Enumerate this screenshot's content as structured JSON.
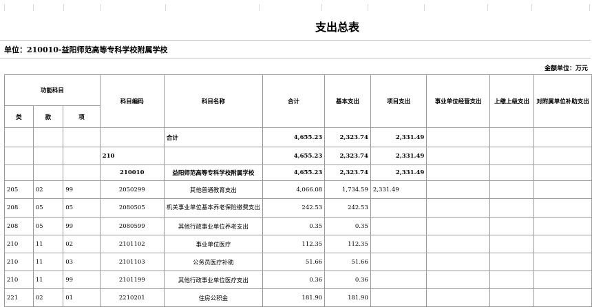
{
  "title": "支出总表",
  "unit_label": "单位：210010-益阳师范高等专科学校附属学校",
  "money_unit": "金额单位：万元",
  "headers": {
    "func_subject": "功能科目",
    "subject_code": "科目编码",
    "subject_name": "科目名称",
    "total": "合计",
    "basic": "基本支出",
    "project": "项目支出",
    "operating": "事业单位经营支出",
    "upper": "上缴上级支出",
    "subsidy": "对附属单位补助支出",
    "lei": "类",
    "kuan": "款",
    "xiang": "项"
  },
  "summary_rows": [
    {
      "code": "",
      "name": "合计",
      "total": "4,655.23",
      "basic": "2,323.74",
      "project": "2,331.49"
    },
    {
      "code": "210",
      "name": "",
      "total": "4,655.23",
      "basic": "2,323.74",
      "project": "2,331.49"
    },
    {
      "code": "210010",
      "name": "益阳师范高等专科学校附属学校",
      "total": "4,655.23",
      "basic": "2,323.74",
      "project": "2,331.49"
    }
  ],
  "rows": [
    {
      "lei": "205",
      "kuan": "02",
      "xiang": "99",
      "code": "2050299",
      "name": "其他普通教育支出",
      "total": "4,066.08",
      "basic": "1,734.59",
      "project": "2,331.49"
    },
    {
      "lei": "208",
      "kuan": "05",
      "xiang": "05",
      "code": "2080505",
      "name": "机关事业单位基本养老保险缴费支出",
      "total": "242.53",
      "basic": "242.53",
      "project": ""
    },
    {
      "lei": "208",
      "kuan": "05",
      "xiang": "99",
      "code": "2080599",
      "name": "其他行政事业单位养老支出",
      "total": "0.35",
      "basic": "0.35",
      "project": ""
    },
    {
      "lei": "210",
      "kuan": "11",
      "xiang": "02",
      "code": "2101102",
      "name": "事业单位医疗",
      "total": "112.35",
      "basic": "112.35",
      "project": ""
    },
    {
      "lei": "210",
      "kuan": "11",
      "xiang": "03",
      "code": "2101103",
      "name": "公务员医疗补助",
      "total": "51.66",
      "basic": "51.66",
      "project": ""
    },
    {
      "lei": "210",
      "kuan": "11",
      "xiang": "99",
      "code": "2101199",
      "name": "其他行政事业单位医疗支出",
      "total": "0.36",
      "basic": "0.36",
      "project": ""
    },
    {
      "lei": "221",
      "kuan": "02",
      "xiang": "01",
      "code": "2210201",
      "name": "住房公积金",
      "total": "181.90",
      "basic": "181.90",
      "project": ""
    }
  ]
}
